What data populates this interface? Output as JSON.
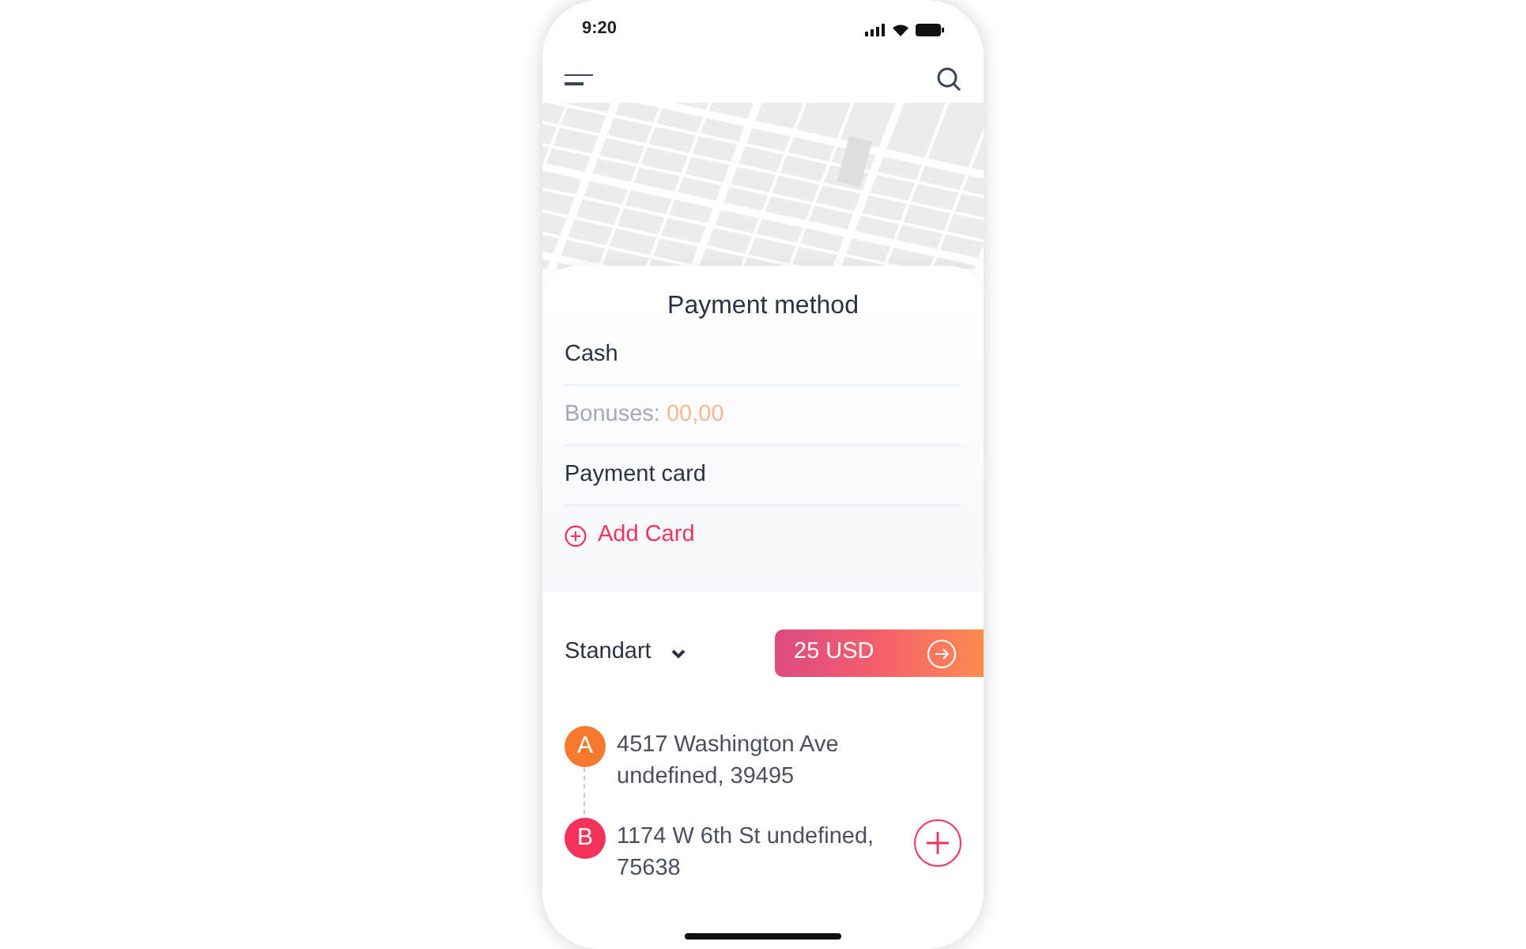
{
  "status_bar": {
    "time": "9:20"
  },
  "payment_method": {
    "title": "Payment method",
    "options": [
      {
        "kind": "option",
        "label": "Cash"
      },
      {
        "kind": "bonus",
        "label": "Bonuses:",
        "value": "00,00"
      },
      {
        "kind": "option",
        "label": "Payment card"
      },
      {
        "kind": "add",
        "label": "Add Card"
      }
    ]
  },
  "tariff": {
    "label": "Standart"
  },
  "price_button": {
    "label": "25 USD"
  },
  "route": [
    {
      "marker": "A",
      "address": "4517 Washington Ave undefined, 39495",
      "color": "#f7792d"
    },
    {
      "marker": "B",
      "address": "1174 W 6th St undefined, 75638",
      "color": "#f4325b"
    }
  ]
}
